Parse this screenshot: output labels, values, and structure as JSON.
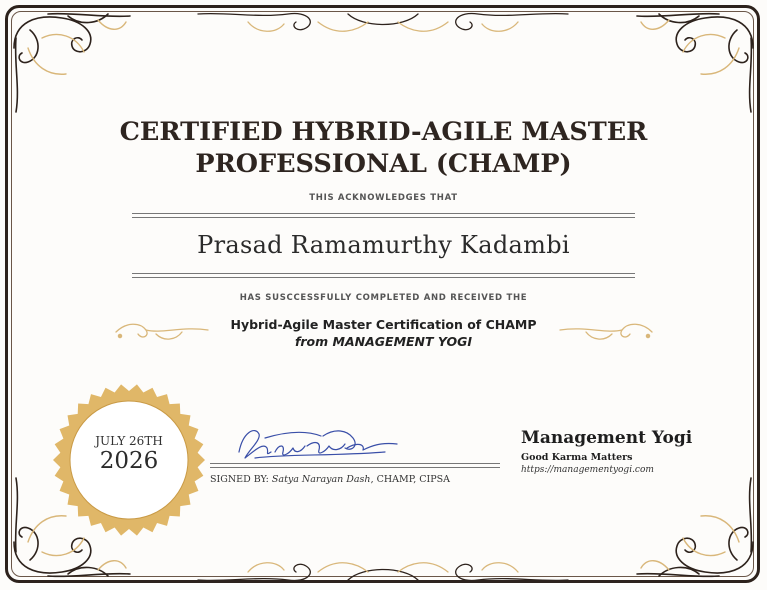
{
  "certificate": {
    "title_line_1": "CERTIFIED HYBRID-AGILE MASTER",
    "title_line_2": "PROFESSIONAL (CHAMP)",
    "acknowledges_text": "THIS ACKNOWLEDGES THAT",
    "recipient_name": "Prasad Ramamurthy Kadambi",
    "completed_text": "HAS SUSCCESSFULLY COMPLETED AND RECEIVED THE",
    "course_name": "Hybrid-Agile Master Certification of CHAMP",
    "issuer_line": "from MANAGEMENT YOGI"
  },
  "seal": {
    "date_label": "JULY 26TH",
    "year": "2026"
  },
  "signature": {
    "signed_by_label": "SIGNED BY:",
    "signer_name": "Satya Narayan Dash",
    "signer_credentials": ", CHAMP, CIPSA"
  },
  "organization": {
    "name": "Management Yogi",
    "tagline": "Good Karma Matters",
    "url": "https://managementyogi.com"
  },
  "colors": {
    "frame_dark": "#2d221c",
    "gold_ornament": "#d9b77a",
    "seal_gold": "#e0b768",
    "ink_blue": "#3a4fa8"
  }
}
